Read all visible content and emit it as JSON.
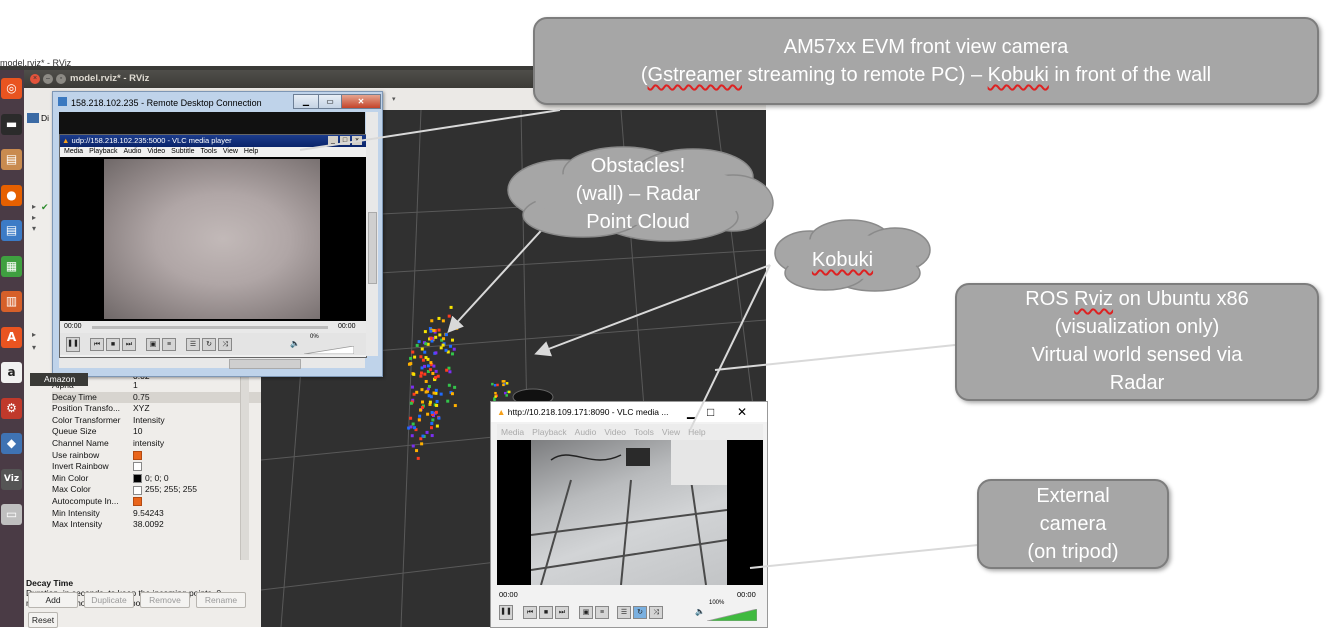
{
  "ubuntu": {
    "window_caption": "model.rviz* - RViz",
    "launcher_icons": [
      {
        "name": "ubuntu-dash-icon",
        "glyph": "◎",
        "color": "#e95420"
      },
      {
        "name": "terminal-icon",
        "glyph": "▬",
        "color": "#2b2b2b"
      },
      {
        "name": "files-icon",
        "glyph": "▤",
        "color": "#c98b4f"
      },
      {
        "name": "firefox-icon",
        "glyph": "●",
        "color": "#e66000"
      },
      {
        "name": "writer-icon",
        "glyph": "▤",
        "color": "#3c7bc6"
      },
      {
        "name": "calc-icon",
        "glyph": "▦",
        "color": "#3fa040"
      },
      {
        "name": "impress-icon",
        "glyph": "▥",
        "color": "#d6602a"
      },
      {
        "name": "software-center-icon",
        "glyph": "A",
        "color": "#e95420"
      },
      {
        "name": "amazon-icon",
        "glyph": "a",
        "color": "#f1f1f1"
      },
      {
        "name": "settings-icon",
        "glyph": "⚙",
        "color": "#c0392b"
      },
      {
        "name": "python-icon",
        "glyph": "◆",
        "color": "#3f73b3"
      },
      {
        "name": "rviz-icon",
        "glyph": "Viz",
        "color": "#555555"
      },
      {
        "name": "drive-icon",
        "glyph": "▭",
        "color": "#bfbfbf"
      }
    ],
    "amazon_tooltip": "Amazon"
  },
  "rviz": {
    "title": "model.rviz* - RViz",
    "displays_tab": "Di",
    "selected_prop_header": "0.02",
    "properties": [
      {
        "key": "Alpha",
        "value": "1",
        "check": null
      },
      {
        "key": "Decay Time",
        "value": "0.75",
        "check": null
      },
      {
        "key": "Position Transfo...",
        "value": "XYZ",
        "check": null
      },
      {
        "key": "Color Transformer",
        "value": "Intensity",
        "check": null
      },
      {
        "key": "Queue Size",
        "value": "10",
        "check": null
      },
      {
        "key": "Channel Name",
        "value": "intensity",
        "check": null
      },
      {
        "key": "Use rainbow",
        "value": "",
        "check": "on"
      },
      {
        "key": "Invert Rainbow",
        "value": "",
        "check": "off"
      },
      {
        "key": "Min Color",
        "value": "0; 0; 0",
        "check": "black"
      },
      {
        "key": "Max Color",
        "value": "255; 255; 255",
        "check": "off"
      },
      {
        "key": "Autocompute In...",
        "value": "",
        "check": "on"
      },
      {
        "key": "Min Intensity",
        "value": "9.54243",
        "check": null
      },
      {
        "key": "Max Intensity",
        "value": "38.0092",
        "check": null
      }
    ],
    "help_title": "Decay Time",
    "help_text": "Duration, in seconds, to keep the incoming points. 0 means only show the latest points.",
    "buttons": {
      "add": "Add",
      "duplicate": "Duplicate",
      "remove": "Remove",
      "rename": "Rename"
    },
    "reset": "Reset"
  },
  "remote_desktop": {
    "title": "158.218.102.235 - Remote Desktop Connection",
    "vlc": {
      "title": "udp://158.218.102.235:5000 - VLC media player",
      "menu": [
        "Media",
        "Playback",
        "Audio",
        "Video",
        "Subtitle",
        "Tools",
        "View",
        "Help"
      ],
      "time_left": "00:00",
      "time_right": "00:00",
      "volume": "0%"
    }
  },
  "vlc2": {
    "title": "http://10.218.109.171:8090 - VLC media ...",
    "menu": [
      "Media",
      "Playback",
      "Audio",
      "Video",
      "Tools",
      "View",
      "Help"
    ],
    "time_left": "00:00",
    "time_right": "00:00",
    "volume": "100%"
  },
  "callouts": {
    "front_camera": {
      "line1": "AM57xx  EVM  front view camera",
      "line2_a": "(",
      "line2_gst": "Gstreamer",
      "line2_b": " streaming to remote PC) – ",
      "line2_kob": "Kobuki",
      "line2_c": " in front of the wall"
    },
    "obstacles": {
      "line1": "Obstacles!",
      "line2": "(wall) – Radar",
      "line3": "Point Cloud"
    },
    "kobuki": {
      "text": "Kobuki"
    },
    "ros_rviz": {
      "line1_a": "ROS ",
      "line1_rviz": "Rviz",
      "line1_b": " on Ubuntu x86",
      "line2": "(visualization only)",
      "line3": "Virtual world sensed via",
      "line4": "Radar"
    },
    "external": {
      "line1": "External",
      "line2": "camera",
      "line3": "(on tripod)"
    }
  },
  "colors": {
    "callout_fill": "#a6a6a6",
    "callout_border": "#7d7d7d",
    "viewport": "#303030"
  }
}
